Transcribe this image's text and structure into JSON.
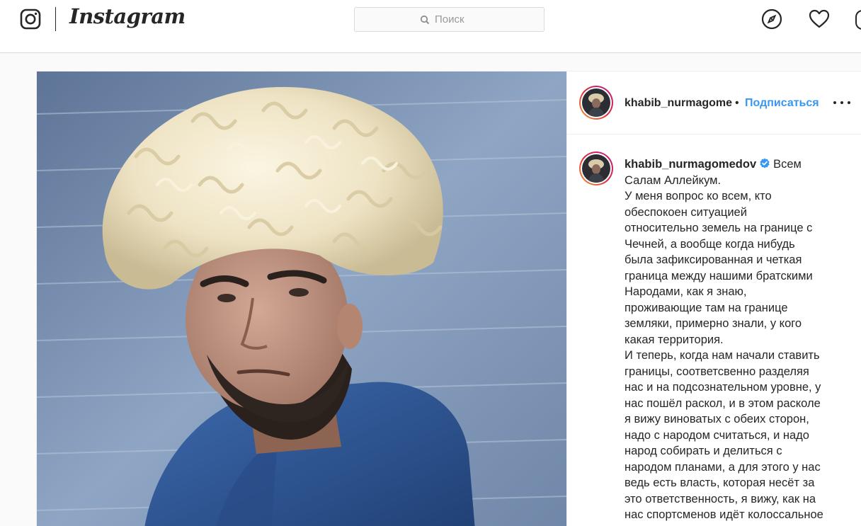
{
  "header": {
    "brand": "Instagram",
    "search": {
      "placeholder": "Поиск",
      "icon": "search-icon"
    },
    "icons": [
      "instagram-glyph-icon",
      "compass-icon",
      "heart-icon",
      "profile-icon"
    ]
  },
  "post": {
    "image": {
      "subject": "man-in-white-papakha-hat-blue-hoodie",
      "background_color": "#7a8fb0"
    },
    "header": {
      "username": "khabib_nurmagomedov",
      "username_display": "khabib_nurmagome",
      "separator": "•",
      "follow_label": "Подписаться",
      "more_icon": "more-dots-icon"
    },
    "caption": {
      "username": "khabib_nurmagomedov",
      "verified": true,
      "first_word": "Всем",
      "lines": [
        "Салам Аллейкум.",
        "У меня вопрос ко всем, кто",
        "обеспокоен ситуацией",
        "относительно земель на границе с",
        "Чечней, а вообще когда нибудь",
        "была зафиксированная и четкая",
        "граница между нашими братскими",
        "Народами, как я знаю,",
        "проживающие там на границе",
        "земляки, примерно знали, у кого",
        "какая территория.",
        "И теперь, когда нам начали ставить",
        "границы, соответсвенно разделяя",
        "нас и на подсознательном уровне, у",
        "нас пошёл раскол, и в этом расколе",
        "я вижу виноватых с обеих сторон,",
        "надо с народом считаться, и надо",
        "народ собирать и делиться с",
        "народом планами, а для этого у нас",
        "ведь есть власть, которая несёт за",
        "это ответственность, я вижу, как на",
        "нас спортсменов идёт колоссальное"
      ]
    }
  },
  "colors": {
    "accent": "#3897f0",
    "text": "#262626",
    "border": "#dbdbdb",
    "background": "#fafafa"
  }
}
